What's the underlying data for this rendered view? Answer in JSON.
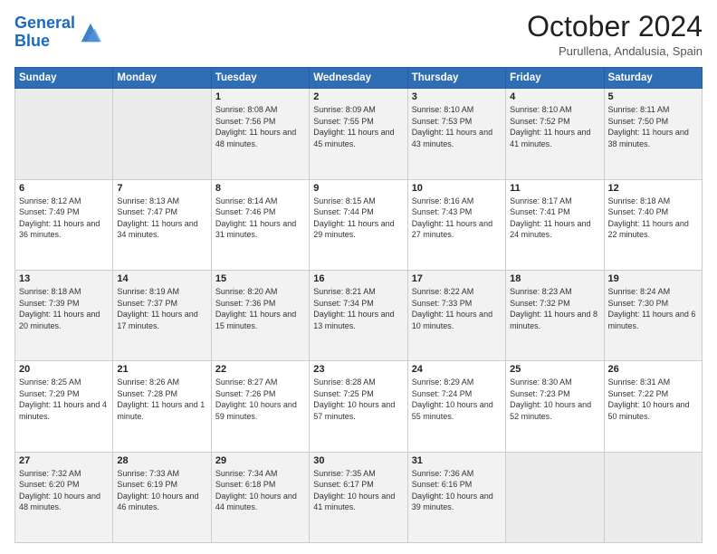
{
  "header": {
    "logo_line1": "General",
    "logo_line2": "Blue",
    "month": "October 2024",
    "location": "Purullena, Andalusia, Spain"
  },
  "weekdays": [
    "Sunday",
    "Monday",
    "Tuesday",
    "Wednesday",
    "Thursday",
    "Friday",
    "Saturday"
  ],
  "weeks": [
    [
      {
        "day": "",
        "info": ""
      },
      {
        "day": "",
        "info": ""
      },
      {
        "day": "1",
        "info": "Sunrise: 8:08 AM\nSunset: 7:56 PM\nDaylight: 11 hours and 48 minutes."
      },
      {
        "day": "2",
        "info": "Sunrise: 8:09 AM\nSunset: 7:55 PM\nDaylight: 11 hours and 45 minutes."
      },
      {
        "day": "3",
        "info": "Sunrise: 8:10 AM\nSunset: 7:53 PM\nDaylight: 11 hours and 43 minutes."
      },
      {
        "day": "4",
        "info": "Sunrise: 8:10 AM\nSunset: 7:52 PM\nDaylight: 11 hours and 41 minutes."
      },
      {
        "day": "5",
        "info": "Sunrise: 8:11 AM\nSunset: 7:50 PM\nDaylight: 11 hours and 38 minutes."
      }
    ],
    [
      {
        "day": "6",
        "info": "Sunrise: 8:12 AM\nSunset: 7:49 PM\nDaylight: 11 hours and 36 minutes."
      },
      {
        "day": "7",
        "info": "Sunrise: 8:13 AM\nSunset: 7:47 PM\nDaylight: 11 hours and 34 minutes."
      },
      {
        "day": "8",
        "info": "Sunrise: 8:14 AM\nSunset: 7:46 PM\nDaylight: 11 hours and 31 minutes."
      },
      {
        "day": "9",
        "info": "Sunrise: 8:15 AM\nSunset: 7:44 PM\nDaylight: 11 hours and 29 minutes."
      },
      {
        "day": "10",
        "info": "Sunrise: 8:16 AM\nSunset: 7:43 PM\nDaylight: 11 hours and 27 minutes."
      },
      {
        "day": "11",
        "info": "Sunrise: 8:17 AM\nSunset: 7:41 PM\nDaylight: 11 hours and 24 minutes."
      },
      {
        "day": "12",
        "info": "Sunrise: 8:18 AM\nSunset: 7:40 PM\nDaylight: 11 hours and 22 minutes."
      }
    ],
    [
      {
        "day": "13",
        "info": "Sunrise: 8:18 AM\nSunset: 7:39 PM\nDaylight: 11 hours and 20 minutes."
      },
      {
        "day": "14",
        "info": "Sunrise: 8:19 AM\nSunset: 7:37 PM\nDaylight: 11 hours and 17 minutes."
      },
      {
        "day": "15",
        "info": "Sunrise: 8:20 AM\nSunset: 7:36 PM\nDaylight: 11 hours and 15 minutes."
      },
      {
        "day": "16",
        "info": "Sunrise: 8:21 AM\nSunset: 7:34 PM\nDaylight: 11 hours and 13 minutes."
      },
      {
        "day": "17",
        "info": "Sunrise: 8:22 AM\nSunset: 7:33 PM\nDaylight: 11 hours and 10 minutes."
      },
      {
        "day": "18",
        "info": "Sunrise: 8:23 AM\nSunset: 7:32 PM\nDaylight: 11 hours and 8 minutes."
      },
      {
        "day": "19",
        "info": "Sunrise: 8:24 AM\nSunset: 7:30 PM\nDaylight: 11 hours and 6 minutes."
      }
    ],
    [
      {
        "day": "20",
        "info": "Sunrise: 8:25 AM\nSunset: 7:29 PM\nDaylight: 11 hours and 4 minutes."
      },
      {
        "day": "21",
        "info": "Sunrise: 8:26 AM\nSunset: 7:28 PM\nDaylight: 11 hours and 1 minute."
      },
      {
        "day": "22",
        "info": "Sunrise: 8:27 AM\nSunset: 7:26 PM\nDaylight: 10 hours and 59 minutes."
      },
      {
        "day": "23",
        "info": "Sunrise: 8:28 AM\nSunset: 7:25 PM\nDaylight: 10 hours and 57 minutes."
      },
      {
        "day": "24",
        "info": "Sunrise: 8:29 AM\nSunset: 7:24 PM\nDaylight: 10 hours and 55 minutes."
      },
      {
        "day": "25",
        "info": "Sunrise: 8:30 AM\nSunset: 7:23 PM\nDaylight: 10 hours and 52 minutes."
      },
      {
        "day": "26",
        "info": "Sunrise: 8:31 AM\nSunset: 7:22 PM\nDaylight: 10 hours and 50 minutes."
      }
    ],
    [
      {
        "day": "27",
        "info": "Sunrise: 7:32 AM\nSunset: 6:20 PM\nDaylight: 10 hours and 48 minutes."
      },
      {
        "day": "28",
        "info": "Sunrise: 7:33 AM\nSunset: 6:19 PM\nDaylight: 10 hours and 46 minutes."
      },
      {
        "day": "29",
        "info": "Sunrise: 7:34 AM\nSunset: 6:18 PM\nDaylight: 10 hours and 44 minutes."
      },
      {
        "day": "30",
        "info": "Sunrise: 7:35 AM\nSunset: 6:17 PM\nDaylight: 10 hours and 41 minutes."
      },
      {
        "day": "31",
        "info": "Sunrise: 7:36 AM\nSunset: 6:16 PM\nDaylight: 10 hours and 39 minutes."
      },
      {
        "day": "",
        "info": ""
      },
      {
        "day": "",
        "info": ""
      }
    ]
  ]
}
